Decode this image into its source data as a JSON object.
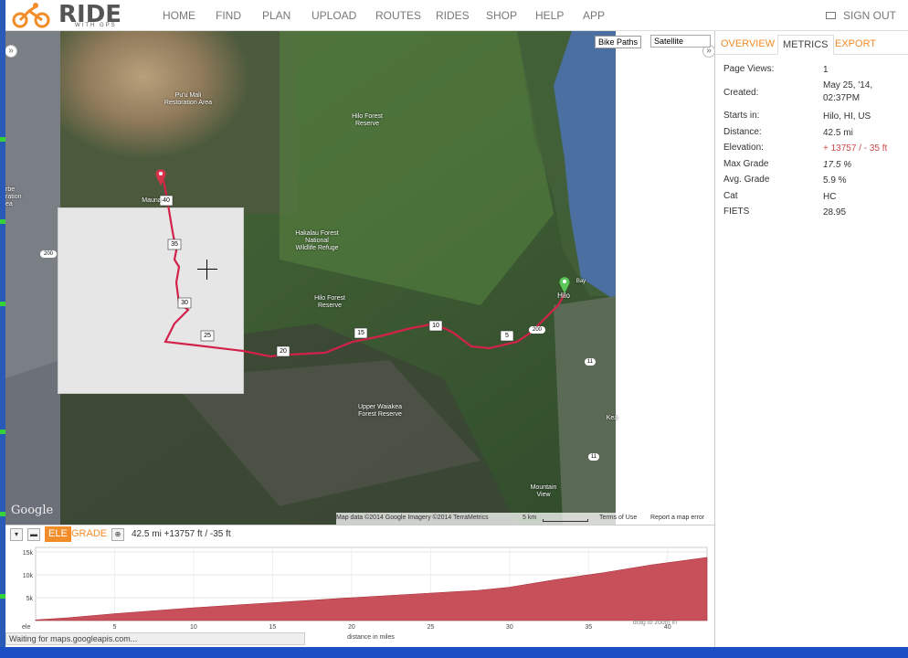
{
  "logo": {
    "name": "RIDE",
    "sub": "WITH GPS"
  },
  "nav": {
    "items": [
      "HOME",
      "FIND",
      "PLAN",
      "UPLOAD",
      "ROUTES",
      "RIDES",
      "SHOP",
      "HELP",
      "APP"
    ],
    "signout": "SIGN OUT"
  },
  "map": {
    "bike_paths": "Bike Paths",
    "map_type": "Satellite",
    "labels": {
      "puu_mali": "Pu'u Mali\nRestoration Area",
      "hilo_forest_1": "Hilo Forest\nReserve",
      "hakalau": "Hakalau Forest\nNational\nWildlife Refuge",
      "hilo_forest_2": "Hilo Forest\nReserve",
      "upper_waiakea": "Upper Waiakea\nForest Reserve",
      "mauna": "Mauna",
      "hilo": "Hilo",
      "bay": "Bay",
      "mountain_view": "Mountain\nView",
      "left_edge": "rbe\nration\nea",
      "keaau": "Kea"
    },
    "route_markers": [
      "40",
      "35",
      "30",
      "25",
      "20",
      "15",
      "10",
      "5"
    ],
    "road_labels": [
      "200",
      "200",
      "11",
      "11"
    ],
    "footer": {
      "data": "Map data ©2014 Google Imagery ©2014 TerraMetrics",
      "scale": "5 km",
      "terms": "Terms of Use",
      "report": "Report a map error"
    },
    "google": "Google"
  },
  "panel": {
    "tabs": [
      "OVERVIEW",
      "METRICS",
      "EXPORT"
    ],
    "active_tab": "METRICS",
    "metrics": [
      {
        "label": "Page Views:",
        "value": "1"
      },
      {
        "label": "Created:",
        "value": "May 25, '14,\n02:37PM"
      },
      {
        "label": "Starts in:",
        "value": "Hilo, HI, US"
      },
      {
        "label": "Distance:",
        "value": "42.5 mi"
      },
      {
        "label": "Elevation:",
        "value": "+ 13757 / - 35 ft"
      },
      {
        "label": "Max Grade",
        "value": "17.5 %"
      },
      {
        "label": "Avg. Grade",
        "value": "5.9 %"
      },
      {
        "label": "Cat",
        "value": "HC"
      },
      {
        "label": "FIETS",
        "value": "28.95"
      }
    ]
  },
  "elevation": {
    "ele_label": "ELE",
    "grade_label": "GRADE",
    "summary": "42.5 mi +13757 ft / -35 ft",
    "axis_corner": "ele",
    "xlabel": "distance in miles",
    "hint": "drag to zoom in",
    "color": "#c8505a"
  },
  "chart_data": {
    "type": "area",
    "xlabel": "distance in miles",
    "ylabel": "ele",
    "x_ticks": [
      "5",
      "10",
      "15",
      "20",
      "25",
      "30",
      "35",
      "40"
    ],
    "y_ticks": [
      "5k",
      "10k",
      "15k"
    ],
    "xlim": [
      0,
      42.5
    ],
    "ylim": [
      0,
      16000
    ],
    "x": [
      0,
      2,
      5,
      10,
      15,
      20,
      25,
      28,
      30,
      33,
      36,
      39,
      42.5
    ],
    "values": [
      150,
      600,
      1500,
      2800,
      3900,
      5000,
      6000,
      6600,
      7300,
      9000,
      10500,
      12200,
      13800
    ]
  },
  "status": "Waiting for maps.googleapis.com..."
}
